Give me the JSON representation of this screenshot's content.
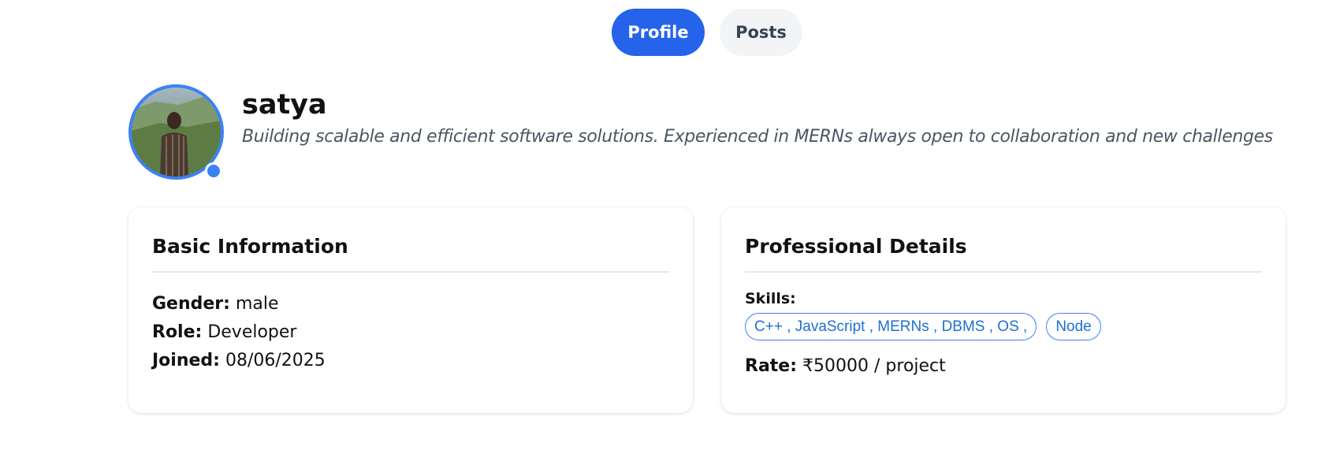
{
  "tabs": [
    {
      "label": "Profile",
      "active": true
    },
    {
      "label": "Posts",
      "active": false
    }
  ],
  "profile": {
    "name": "satya",
    "bio": "Building scalable and efficient software solutions. Experienced in MERNs always open to collaboration and new challenges",
    "online": true
  },
  "basic_info": {
    "title": "Basic Information",
    "gender_label": "Gender:",
    "gender": "male",
    "role_label": "Role:",
    "role": "Developer",
    "joined_label": "Joined:",
    "joined": "08/06/2025"
  },
  "professional": {
    "title": "Professional Details",
    "skills_label": "Skills:",
    "skills": [
      "C++ , JavaScript , MERNs , DBMS , OS ,",
      "Node"
    ],
    "rate_label": "Rate:",
    "rate": "₹50000 / project"
  },
  "colors": {
    "accent": "#2563eb",
    "status_dot": "#3b82f6",
    "chip_text": "#1d6fd8"
  }
}
